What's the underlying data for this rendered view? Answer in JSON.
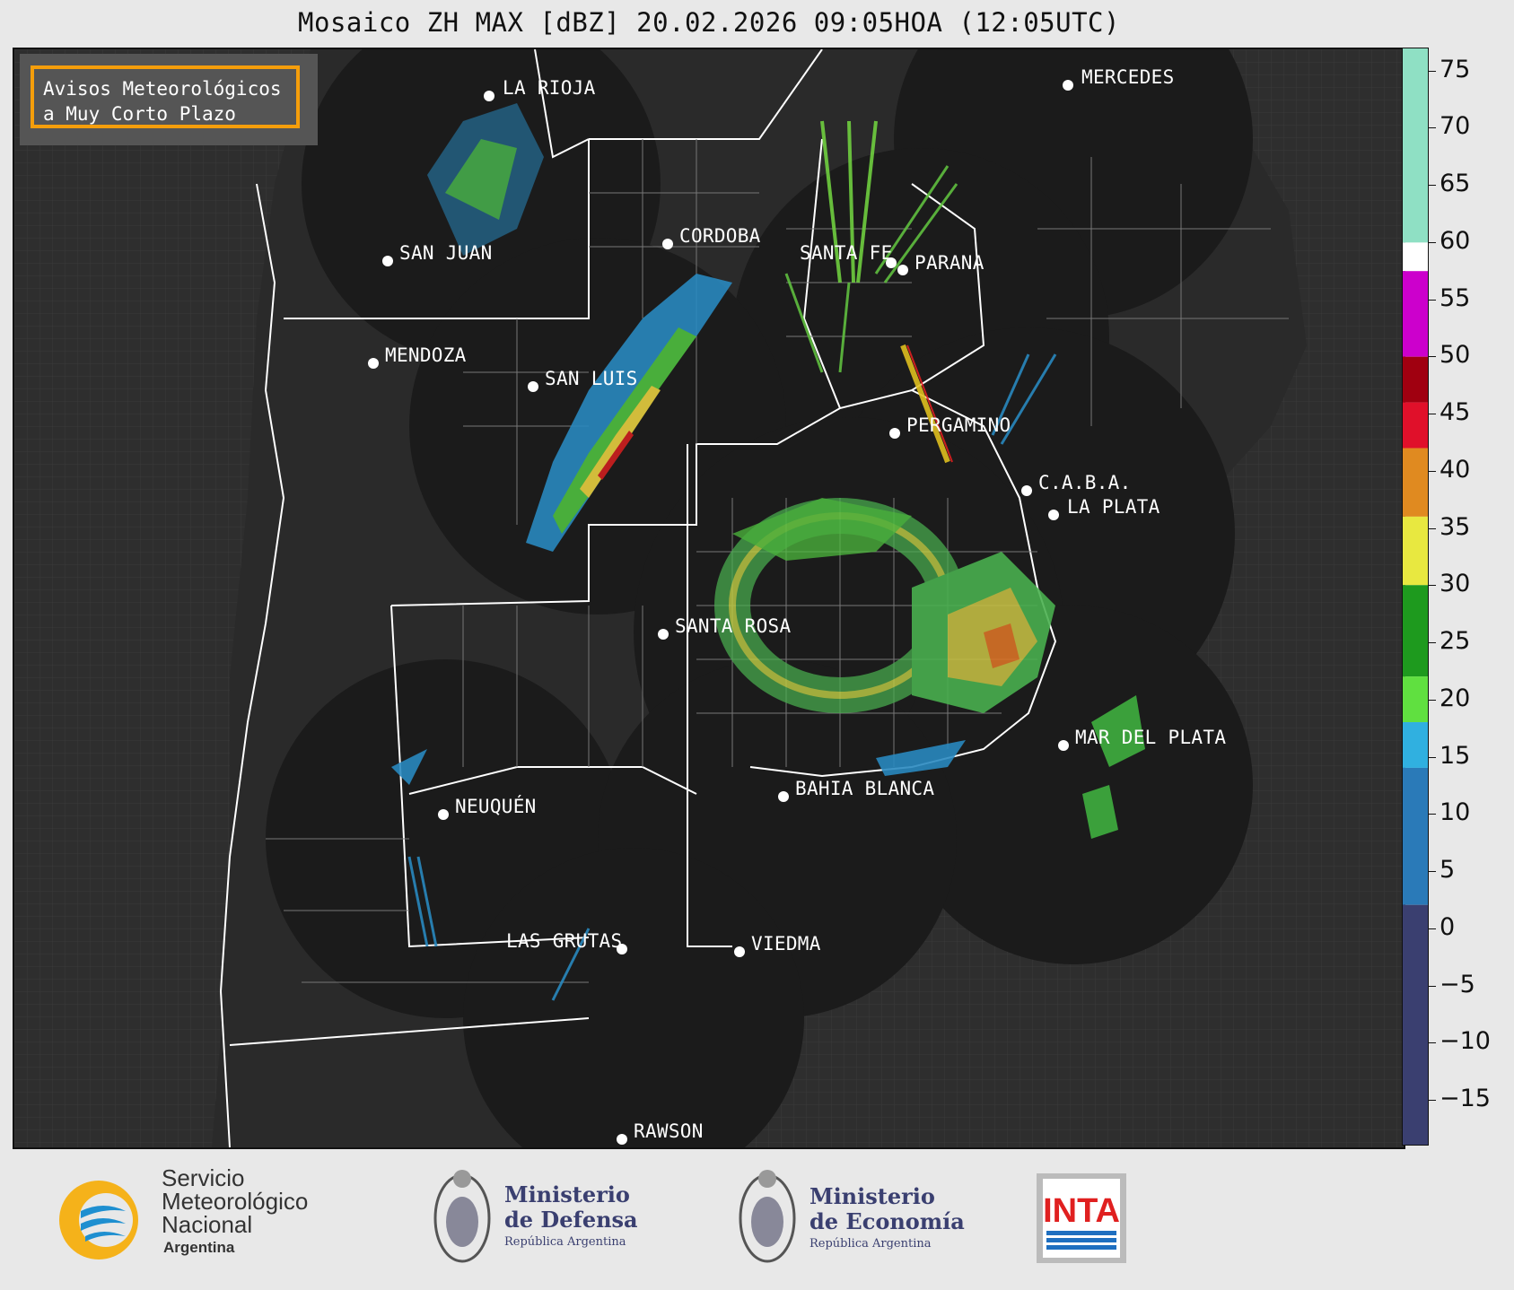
{
  "title": "Mosaico ZH MAX [dBZ] 20.02.2026 09:05HOA (12:05UTC)",
  "avisos": {
    "line1": "Avisos Meteorológicos",
    "line2": "a Muy Corto Plazo"
  },
  "cities": [
    {
      "id": "la-rioja",
      "name": "LA RIOJA"
    },
    {
      "id": "mercedes",
      "name": "MERCEDES"
    },
    {
      "id": "san-juan",
      "name": "SAN JUAN"
    },
    {
      "id": "cordoba",
      "name": "CORDOBA"
    },
    {
      "id": "santa-fe",
      "name": "SANTA FE"
    },
    {
      "id": "parana",
      "name": "PARANA"
    },
    {
      "id": "mendoza",
      "name": "MENDOZA"
    },
    {
      "id": "san-luis",
      "name": "SAN LUIS"
    },
    {
      "id": "pergamino",
      "name": "PERGAMINO"
    },
    {
      "id": "caba",
      "name": "C.A.B.A."
    },
    {
      "id": "la-plata",
      "name": "LA PLATA"
    },
    {
      "id": "santa-rosa",
      "name": "SANTA ROSA"
    },
    {
      "id": "mar-del-plata",
      "name": "MAR DEL PLATA"
    },
    {
      "id": "bahia-blanca",
      "name": "BAHIA BLANCA"
    },
    {
      "id": "neuquen",
      "name": "NEUQUÉN"
    },
    {
      "id": "las-grutas",
      "name": "LAS GRUTAS"
    },
    {
      "id": "viedma",
      "name": "VIEDMA"
    },
    {
      "id": "rawson",
      "name": "RAWSON"
    }
  ],
  "colorbar": {
    "unit": "dBZ",
    "ticks": [
      "75",
      "70",
      "65",
      "60",
      "55",
      "50",
      "45",
      "40",
      "35",
      "30",
      "25",
      "20",
      "15",
      "10",
      "5",
      "0",
      "−5",
      "−10",
      "−15"
    ],
    "colors": {
      "high": "#8fe0c4",
      "white": "#ffffff",
      "magenta": "#cc00cc",
      "darkred": "#a00010",
      "red": "#e0102a",
      "orange": "#e08a20",
      "yellow": "#e8e840",
      "green": "#1e9a1e",
      "lightgreen": "#60e040",
      "cyan": "#30b0e0",
      "blue": "#2a7ab8",
      "navy": "#3a3f70"
    }
  },
  "logos": {
    "smn": {
      "line1": "Servicio",
      "line2": "Meteorológico",
      "line3": "Nacional",
      "line4": "Argentina"
    },
    "defensa": {
      "line1": "Ministerio",
      "line2": "de Defensa",
      "line3": "República Argentina"
    },
    "economia": {
      "line1": "Ministerio",
      "line2": "de Economía",
      "line3": "República Argentina"
    },
    "inta": {
      "text": "INTA"
    }
  }
}
